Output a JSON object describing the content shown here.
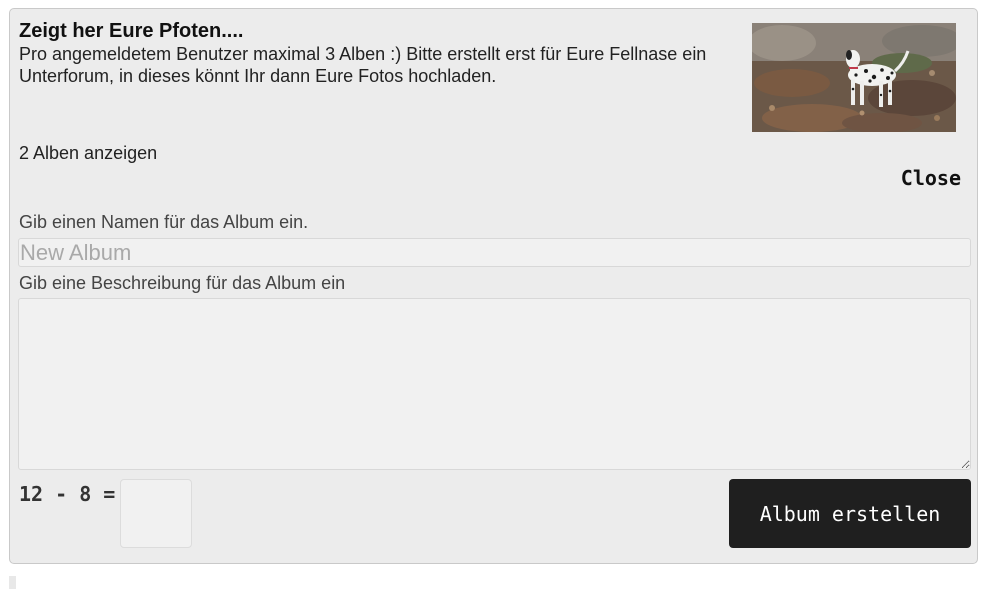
{
  "album": {
    "title": "Zeigt her Eure Pfoten....",
    "description": "Pro angemeldetem Benutzer maximal 3 Alben :) Bitte erstellt erst für Eure Fellnase ein Unterforum, in dieses könnt Ihr dann Eure Fotos hochladen.",
    "thumbnail_icon": "dalmatian-photo"
  },
  "show_albums_label": "2 Alben anzeigen",
  "close_label": "Close",
  "form": {
    "name_label": "Gib einen Namen für das Album ein.",
    "name_placeholder": "New Album",
    "name_value": "",
    "desc_label": "Gib eine Beschreibung für das Album ein",
    "desc_value": "",
    "captcha_question": "12 - 8 =",
    "captcha_value": "",
    "submit_label": "Album erstellen"
  },
  "colors": {
    "panel_bg": "#ececec",
    "button_bg": "#1f1f1f",
    "button_text": "#ffffff"
  }
}
